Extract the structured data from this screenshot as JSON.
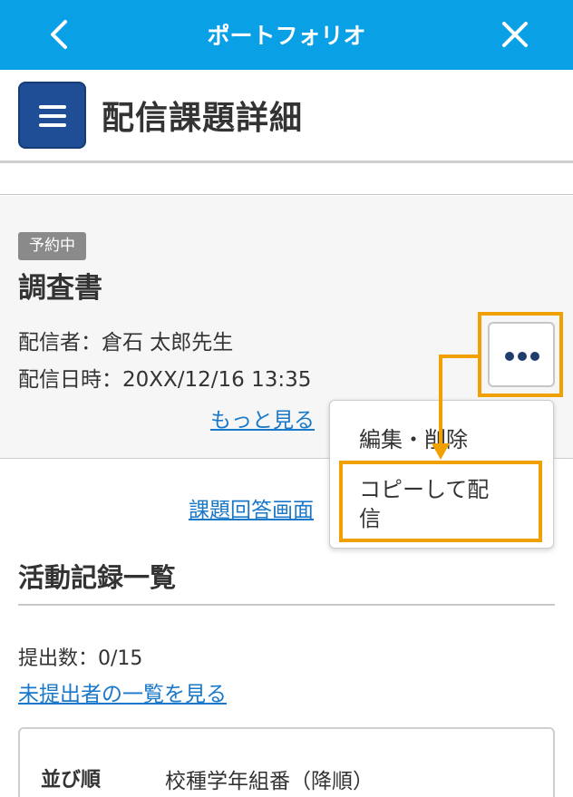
{
  "topbar": {
    "title": "ポートフォリオ",
    "back_icon": "chevron-left-icon",
    "close_icon": "close-icon",
    "bg_color": "#0aa0e6"
  },
  "header": {
    "menu_icon": "hamburger-menu-icon",
    "title": "配信課題詳細"
  },
  "task": {
    "badge": "予約中",
    "title": "調査書",
    "sender": "配信者：倉石 太郎先生",
    "datetime": "配信日時：20XX/12/16 13:35",
    "more_link": "もっと見る"
  },
  "actions": {
    "more_icon": "more-horizontal-icon"
  },
  "dropdown": {
    "items": [
      "編集・削除",
      "コピーして配信"
    ],
    "copy_line1": "コピーして配",
    "copy_line2": "信"
  },
  "answer_link": "課題回答画面",
  "activity": {
    "section_title": "活動記録一覧",
    "submit_count": "提出数：0/15",
    "unsubmitted_link": "未提出者の一覧を見る",
    "sort_label": "並び順",
    "sort_value": "校種学年組番（降順）"
  },
  "colors": {
    "accent": "#0aa0e6",
    "menu_button": "#1f4e96",
    "highlight": "#f0a000",
    "link": "#1a78c8"
  }
}
